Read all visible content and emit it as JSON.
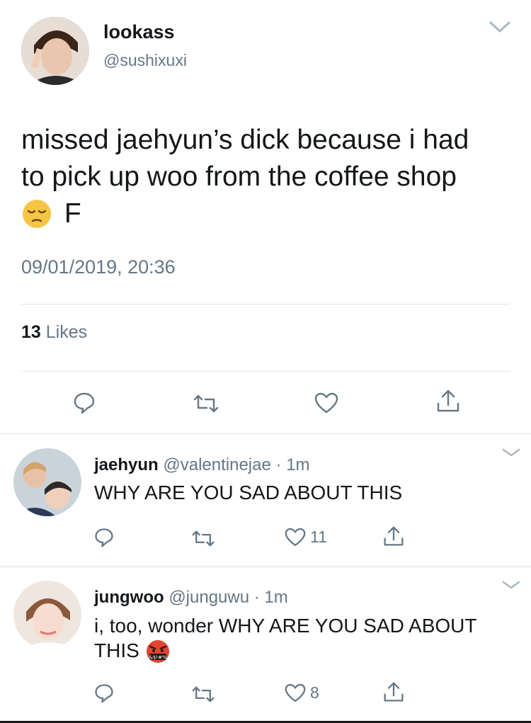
{
  "tweet": {
    "display_name": "lookass",
    "handle": "@sushixuxi",
    "text_line1": "missed jaehyun’s dick because i had",
    "text_line2": "to pick up woo from the coffee shop",
    "text_tail": "F",
    "emoji": "pensive-face",
    "timestamp": "09/01/2019, 20:36",
    "likes_count": "13",
    "likes_label": "Likes"
  },
  "replies": [
    {
      "display_name": "jaehyun",
      "handle": "@valentinejae",
      "separator": "·",
      "time": "1m",
      "text": "WHY ARE YOU SAD ABOUT THIS",
      "like_count": "11"
    },
    {
      "display_name": "jungwoo",
      "handle": "@junguwu",
      "separator": "·",
      "time": "1m",
      "text_line1": "i, too, wonder WHY ARE YOU SAD ABOUT",
      "text_line2": "THIS",
      "emoji": "face-with-symbols-on-mouth",
      "emoji_text": "&$!#%",
      "like_count": "8"
    }
  ],
  "colors": {
    "text": "#14171a",
    "secondary": "#657786",
    "divider": "#dfe3e7"
  }
}
